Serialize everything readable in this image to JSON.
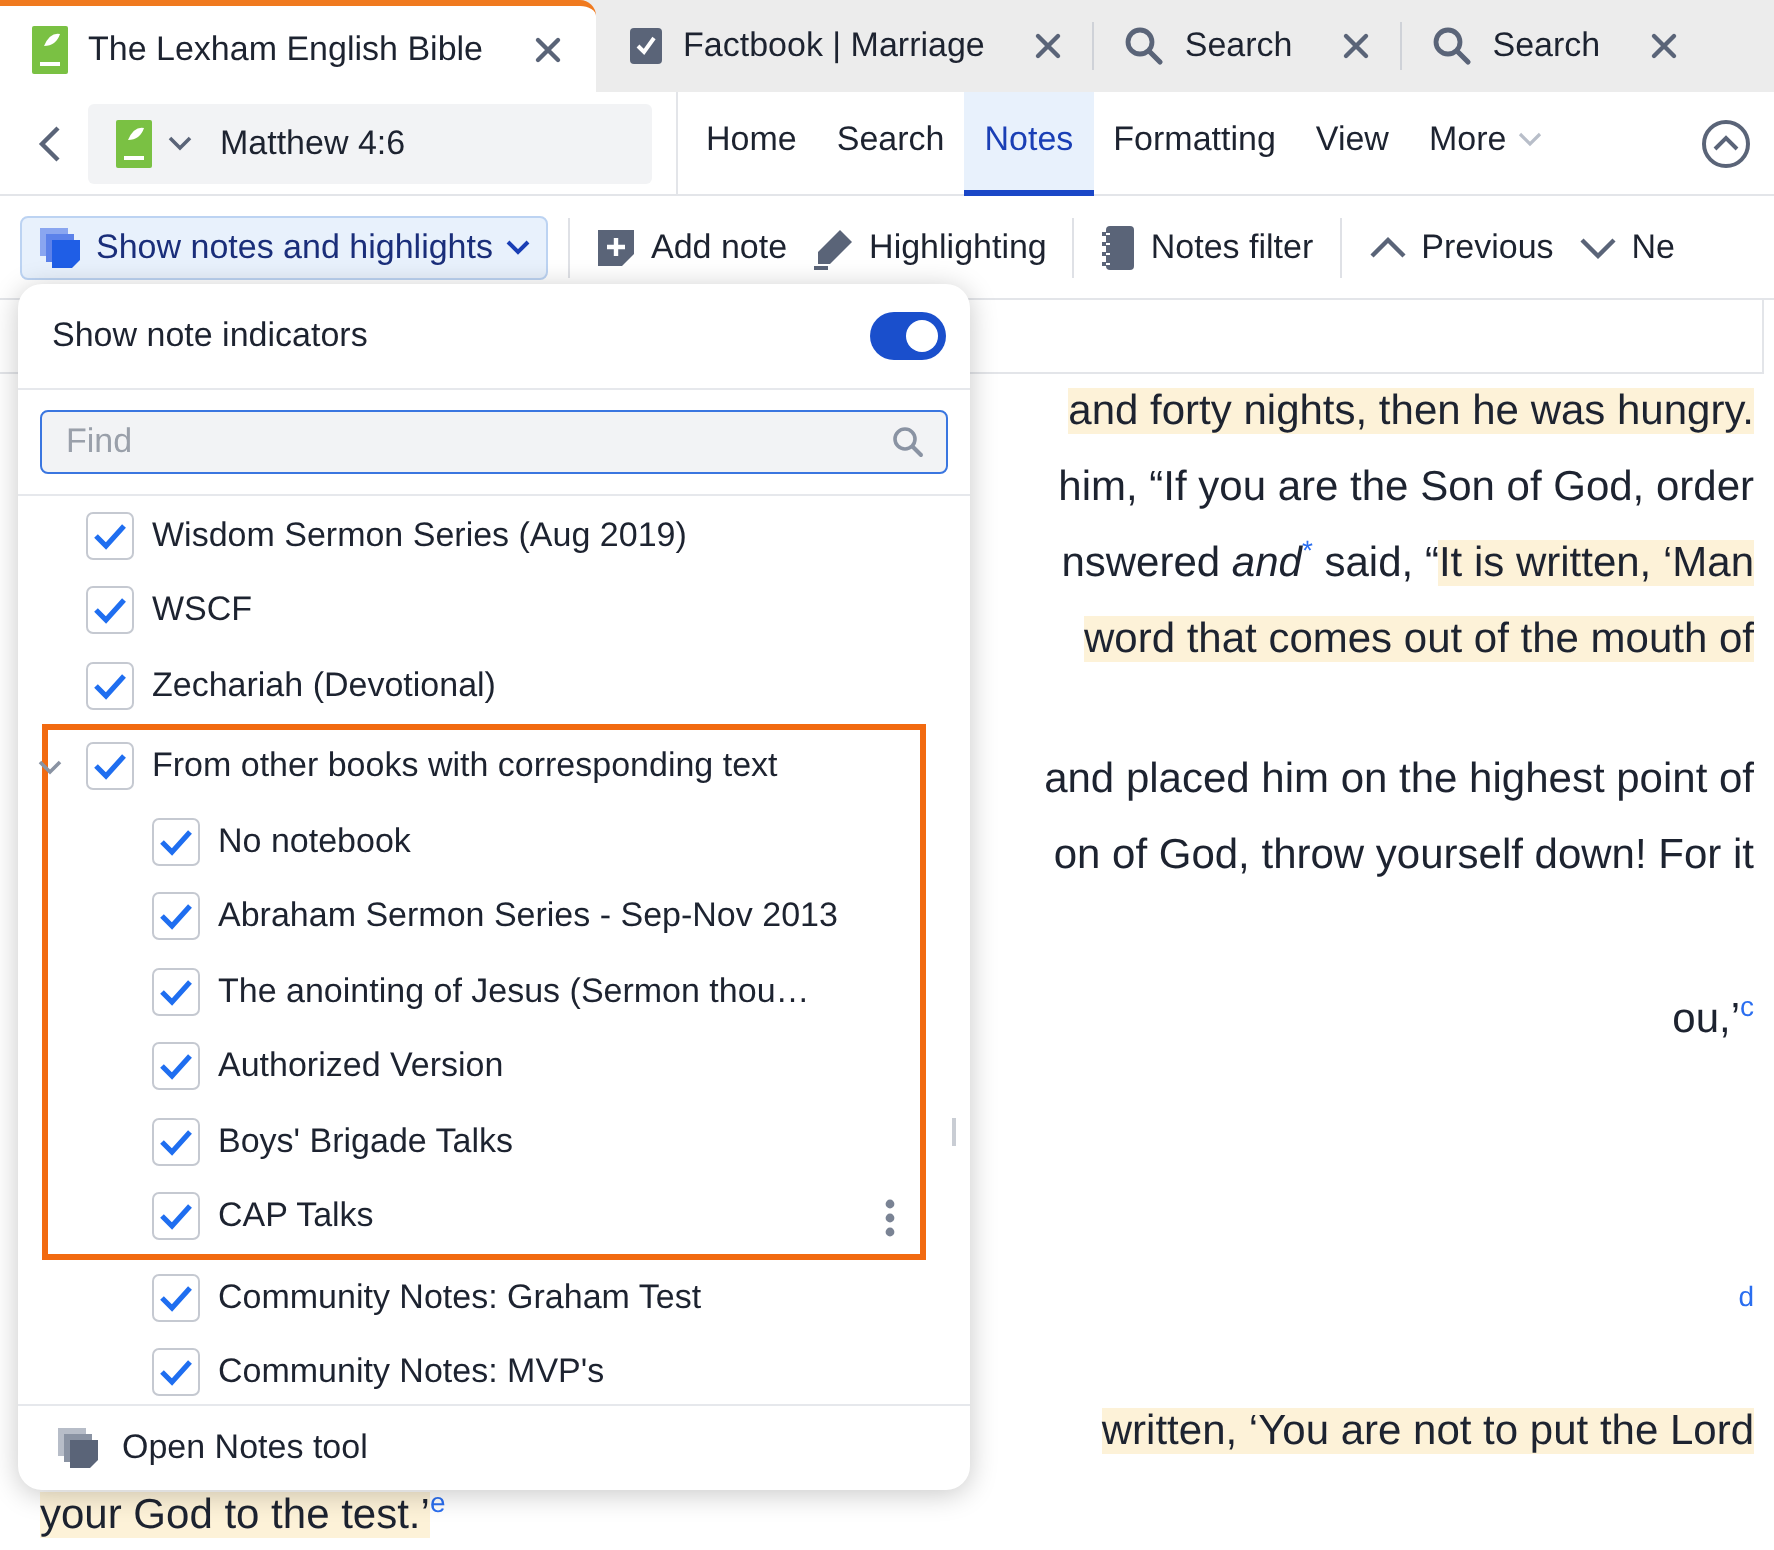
{
  "tabs": [
    {
      "kind": "resource",
      "label": "The Lexham English Bible",
      "selected": true
    },
    {
      "kind": "factbook",
      "label": "Factbook | Marriage",
      "selected": false
    },
    {
      "kind": "search",
      "label": "Search",
      "selected": false
    },
    {
      "kind": "search",
      "label": "Search",
      "selected": false
    }
  ],
  "nav": {
    "resource": "Matthew 4:6"
  },
  "menu_tabs": [
    {
      "label": "Home",
      "selected": false,
      "dropdown": false
    },
    {
      "label": "Search",
      "selected": false,
      "dropdown": false
    },
    {
      "label": "Notes",
      "selected": true,
      "dropdown": false
    },
    {
      "label": "Formatting",
      "selected": false,
      "dropdown": false
    },
    {
      "label": "View",
      "selected": false,
      "dropdown": false
    },
    {
      "label": "More",
      "selected": false,
      "dropdown": true
    }
  ],
  "toolbar": [
    {
      "kind": "notes_menu",
      "label": "Show notes and highlights",
      "open": true
    },
    {
      "kind": "separator"
    },
    {
      "kind": "add_note",
      "label": "Add note"
    },
    {
      "kind": "highlighting",
      "label": "Highlighting"
    },
    {
      "kind": "separator"
    },
    {
      "kind": "notes_filter",
      "label": "Notes filter"
    },
    {
      "kind": "separator"
    },
    {
      "kind": "previous",
      "label": "Previous"
    },
    {
      "kind": "next",
      "label": "Ne"
    }
  ],
  "document": {
    "paragraphs": [
      {
        "lines": [
          {
            "kind": "line",
            "segments": [
              {
                "kind": "text",
                "text": "and forty nights, then he was hungry.",
                "highlighted": true
              }
            ]
          },
          {
            "kind": "line",
            "segments": [
              {
                "kind": "text",
                "text": "him, “If you are the Son of God, order",
                "highlighted": false
              }
            ]
          },
          {
            "kind": "line",
            "segments": [
              {
                "kind": "text",
                "text": "nswered *and*",
                "highlighted": false
              },
              {
                "kind": "note",
                "text": "*",
                "highlighted": false
              },
              {
                "kind": "text",
                "text": " said, “",
                "highlighted": false
              },
              {
                "kind": "text",
                "text": "It is written, ‘Man",
                "highlighted": true
              }
            ]
          },
          {
            "kind": "line",
            "segments": [
              {
                "kind": "text",
                "text": "word that comes out of the mouth of",
                "highlighted": true
              }
            ]
          }
        ]
      },
      {
        "lines": [
          {
            "kind": "line",
            "segments": [
              {
                "kind": "text",
                "text": "and placed him on the highest point of",
                "highlighted": false
              }
            ]
          },
          {
            "kind": "line",
            "segments": [
              {
                "kind": "text",
                "text": "on of God, throw yourself down! For it",
                "highlighted": false
              }
            ]
          }
        ]
      },
      {
        "kind": "poetry",
        "lines": [
          {
            "kind": "fragment",
            "segments": [
              {
                "kind": "text",
                "text": "ou,’",
                "highlighted": false
              },
              {
                "kind": "note",
                "text": "c",
                "highlighted": false
              }
            ]
          },
          {
            "kind": "fragment",
            "segments": [
              {
                "kind": "note",
                "text": "d",
                "highlighted": false
              }
            ]
          }
        ]
      },
      {
        "lines": [
          {
            "kind": "line",
            "segments": [
              {
                "kind": "text",
                "text": "written, ‘You are not to put the Lord",
                "highlighted": true
              }
            ]
          },
          {
            "kind": "last_line",
            "segments": [
              {
                "kind": "text",
                "text": "your God to the test.’",
                "highlighted": true
              },
              {
                "kind": "note",
                "text": "e",
                "highlighted": false
              }
            ]
          }
        ]
      }
    ]
  },
  "notes_popup": {
    "toggle": {
      "label": "Show note indicators",
      "on": true
    },
    "find": {
      "placeholder": "Find"
    },
    "items": [
      {
        "label": "Wisdom Sermon Series (Aug 2019)",
        "checked": true,
        "framed": false
      },
      {
        "label": "WSCF",
        "checked": true,
        "framed": false
      },
      {
        "label": "Zechariah (Devotional)",
        "checked": true,
        "framed": false
      },
      {
        "label": "From other books with corresponding text",
        "checked": true,
        "framed": true,
        "expanded": true,
        "children": [
          {
            "label": "No notebook",
            "checked": true,
            "framed": true
          },
          {
            "label": "Abraham Sermon Series - Sep-Nov 2013",
            "checked": true,
            "framed": true
          },
          {
            "label": "The anointing of Jesus (Sermon thou…",
            "checked": true,
            "framed": true
          },
          {
            "label": "Authorized Version",
            "checked": true,
            "framed": true
          },
          {
            "label": "Boys' Brigade Talks",
            "checked": true,
            "framed": true
          },
          {
            "label": "CAP Talks",
            "checked": true,
            "framed": true,
            "hovered": true
          },
          {
            "label": "Community Notes: Graham Test",
            "checked": true,
            "framed": false
          },
          {
            "label": "Community Notes: MVP's",
            "checked": true,
            "framed": false
          }
        ]
      }
    ],
    "footer": {
      "label": "Open Notes tool"
    }
  }
}
